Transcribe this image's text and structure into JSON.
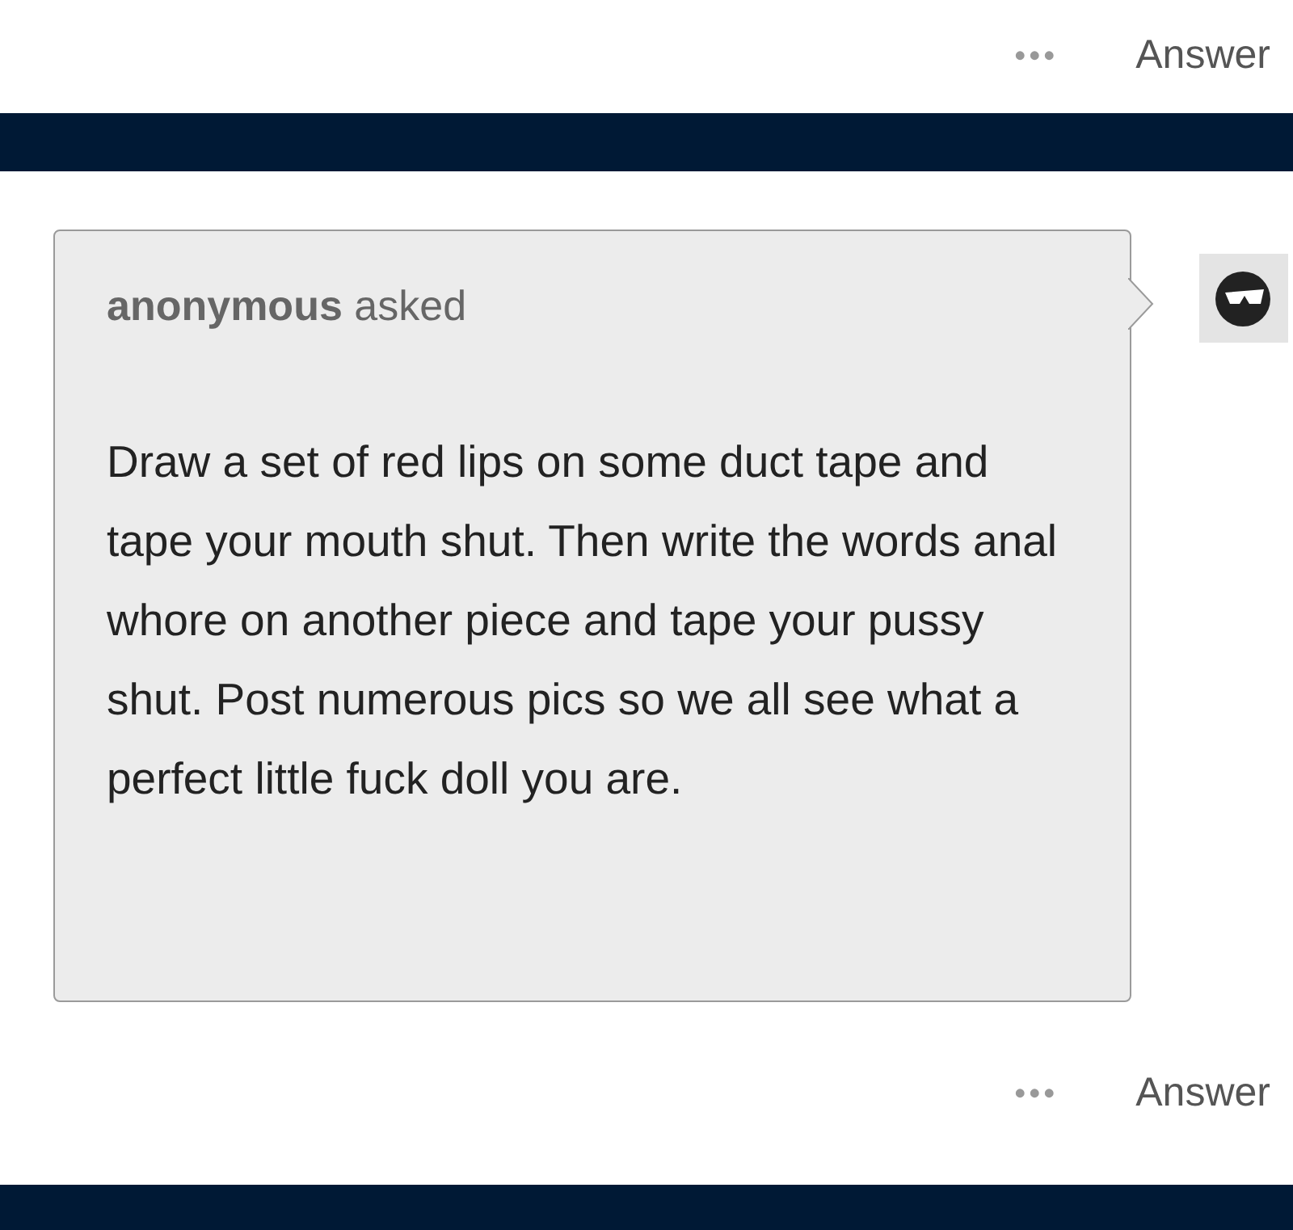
{
  "top_actions": {
    "more": "•••",
    "answer": "Answer"
  },
  "ask": {
    "header": "**anonymous** asked",
    "body": "Draw a set of red lips on some duct tape and tape your mouth shut. Then write the words anal whore on another piece and tape your pussy shut. Post numerous pics so we all see what a perfect little fuck doll you are."
  },
  "bottom_actions": {
    "more": "•••",
    "answer": "Answer"
  }
}
